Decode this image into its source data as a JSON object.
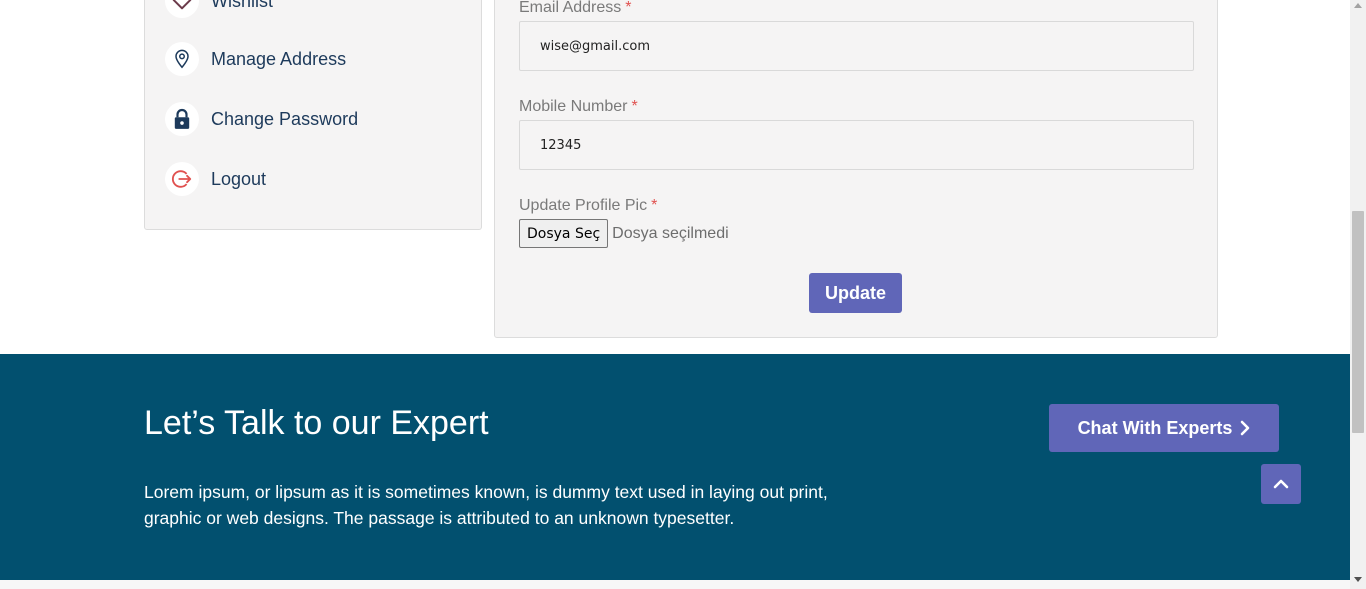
{
  "sidebar": {
    "items": [
      {
        "label": "Wishlist",
        "icon": "heart-icon",
        "color": "#6b3a4a"
      },
      {
        "label": "Manage Address",
        "icon": "map-pin-icon",
        "color": "#1d3a5b"
      },
      {
        "label": "Change Password",
        "icon": "lock-icon",
        "color": "#1d3a5b"
      },
      {
        "label": "Logout",
        "icon": "logout-icon",
        "color": "#e0514f"
      }
    ]
  },
  "form": {
    "email": {
      "label": "Email Address",
      "required": "*",
      "value": "wise@gmail.com"
    },
    "mobile": {
      "label": "Mobile Number",
      "required": "*",
      "value": "12345"
    },
    "profile_pic": {
      "label": "Update Profile Pic",
      "required": "*",
      "button_label": "Dosya Seç",
      "status": "Dosya seçilmedi"
    },
    "update_label": "Update"
  },
  "cta": {
    "title": "Let’s Talk to our Expert",
    "text": "Lorem ipsum, or lipsum as it is sometimes known, is dummy text used in laying out print, graphic or web designs. The passage is attributed to an unknown typesetter.",
    "chat_label": "Chat With Experts"
  },
  "colors": {
    "accent": "#6066b8",
    "band": "#02506f",
    "required": "#e0514f",
    "nav_text": "#1d3a5b"
  }
}
